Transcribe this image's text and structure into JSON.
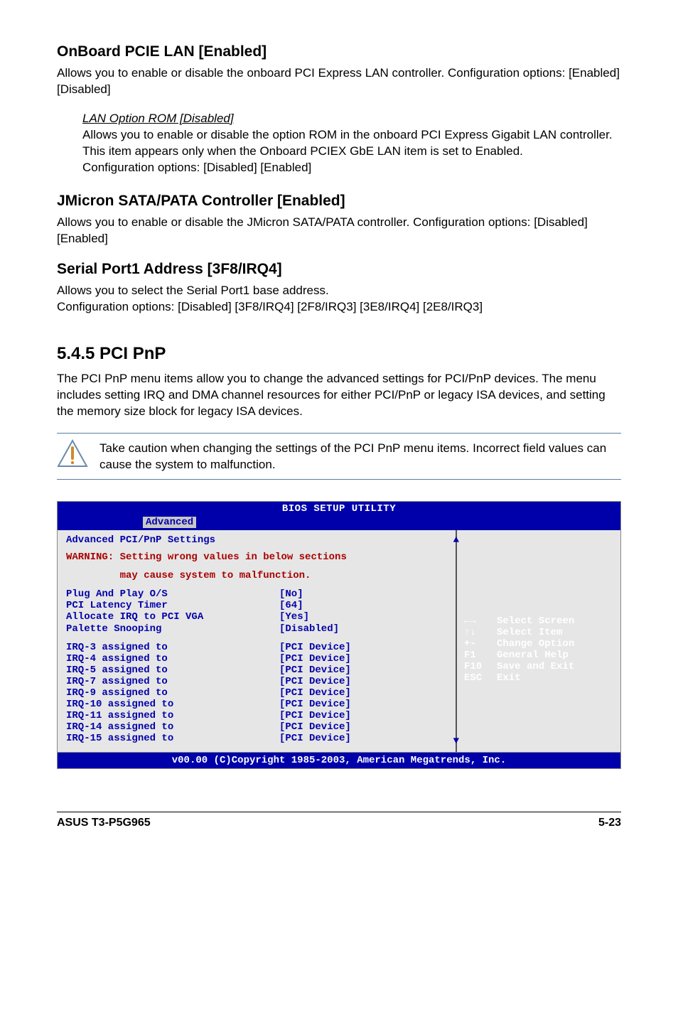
{
  "sections": {
    "pcie_lan": {
      "heading": "OnBoard PCIE LAN [Enabled]",
      "body": "Allows you to enable or disable the onboard PCI Express LAN controller. Configuration options: [Enabled] [Disabled]",
      "sub_heading": "LAN Option ROM [Disabled]",
      "sub_body": "Allows you to enable or disable the option ROM in the onboard PCI Express Gigabit LAN controller. This item appears only when the Onboard PCIEX GbE LAN item is set to Enabled.\nConfiguration options: [Disabled] [Enabled]"
    },
    "jmicron": {
      "heading": "JMicron SATA/PATA Controller [Enabled]",
      "body": "Allows you to enable or disable the JMicron SATA/PATA controller. Configuration options: [Disabled] [Enabled]"
    },
    "serial": {
      "heading": "Serial Port1 Address [3F8/IRQ4]",
      "body": "Allows you to select the Serial Port1 base address.\nConfiguration options: [Disabled] [3F8/IRQ4] [2F8/IRQ3] [3E8/IRQ4] [2E8/IRQ3]"
    },
    "pcipnp": {
      "heading": "5.4.5    PCI PnP",
      "body": "The PCI PnP menu items allow you to change the advanced settings for PCI/PnP devices. The menu includes setting IRQ and DMA channel resources for either PCI/PnP or legacy ISA devices, and setting the memory size block for legacy ISA devices."
    }
  },
  "notice": "Take caution when changing the settings of the PCI PnP menu items. Incorrect field values can cause the system to malfunction.",
  "bios": {
    "title": "BIOS SETUP UTILITY",
    "tab": "Advanced",
    "panel_heading": "Advanced PCI/PnP Settings",
    "warning_line1": "WARNING: Setting wrong values in below sections",
    "warning_line2": "         may cause system to malfunction.",
    "settings": [
      {
        "label": "Plug And Play O/S",
        "value": "[No]"
      },
      {
        "label": "PCI Latency Timer",
        "value": "[64]"
      },
      {
        "label": "Allocate IRQ to PCI VGA",
        "value": "[Yes]"
      },
      {
        "label": "Palette Snooping",
        "value": "[Disabled]"
      }
    ],
    "irq": [
      {
        "label": "IRQ-3 assigned to",
        "value": "[PCI Device]"
      },
      {
        "label": "IRQ-4 assigned to",
        "value": "[PCI Device]"
      },
      {
        "label": "IRQ-5 assigned to",
        "value": "[PCI Device]"
      },
      {
        "label": "IRQ-7 assigned to",
        "value": "[PCI Device]"
      },
      {
        "label": "IRQ-9 assigned to",
        "value": "[PCI Device]"
      },
      {
        "label": "IRQ-10 assigned to",
        "value": "[PCI Device]"
      },
      {
        "label": "IRQ-11 assigned to",
        "value": "[PCI Device]"
      },
      {
        "label": "IRQ-14 assigned to",
        "value": "[PCI Device]"
      },
      {
        "label": "IRQ-15 assigned to",
        "value": "[PCI Device]"
      }
    ],
    "hints": [
      {
        "key": "←→",
        "label": "Select Screen"
      },
      {
        "key": "↑↓",
        "label": "Select Item"
      },
      {
        "key": "+-",
        "label": "Change Option"
      },
      {
        "key": "F1",
        "label": "General Help"
      },
      {
        "key": "F10",
        "label": "Save and Exit"
      },
      {
        "key": "ESC",
        "label": "Exit"
      }
    ],
    "footer": "v00.00 (C)Copyright 1985-2003, American Megatrends, Inc."
  },
  "footer": {
    "left": "ASUS T3-P5G965",
    "right": "5-23"
  }
}
